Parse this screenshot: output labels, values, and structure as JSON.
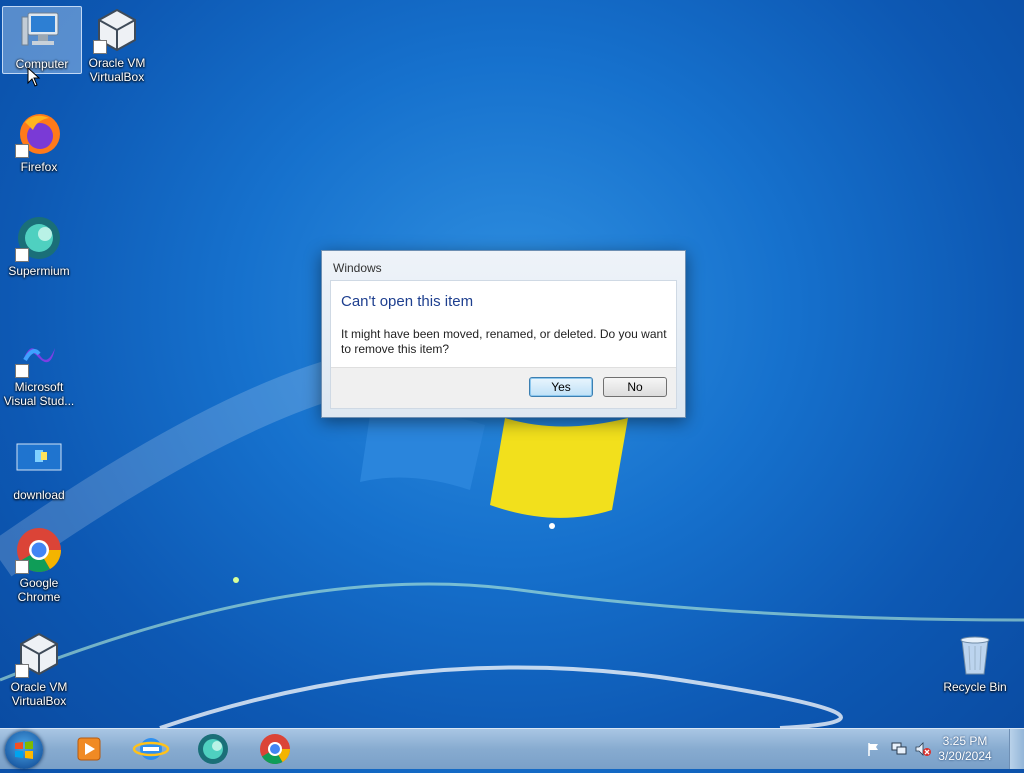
{
  "desktop": {
    "icons": [
      {
        "label": "Computer"
      },
      {
        "label": "Oracle VM VirtualBox"
      },
      {
        "label": "Firefox"
      },
      {
        "label": "Supermium"
      },
      {
        "label": "Microsoft Visual Stud..."
      },
      {
        "label": "download"
      },
      {
        "label": "Google Chrome"
      },
      {
        "label": "Oracle VM VirtualBox"
      },
      {
        "label": "Recycle Bin"
      }
    ]
  },
  "dialog": {
    "title": "Windows",
    "heading": "Can't open this item",
    "message": "It might have been moved, renamed, or deleted. Do you want to remove this item?",
    "yes_label": "Yes",
    "no_label": "No"
  },
  "taskbar": {
    "pinned": [
      "start-orb",
      "media-player-icon",
      "internet-explorer-icon",
      "supermium-icon",
      "chrome-icon"
    ],
    "clock": {
      "time": "3:25 PM",
      "date": "3/20/2024"
    },
    "tray_icons": [
      "action-center-flag-icon",
      "network-icon",
      "volume-muted-icon"
    ]
  },
  "colors": {
    "desktop": "#1671cd",
    "dialog_heading": "#1e3f8f",
    "taskbar": "#87abd0"
  }
}
